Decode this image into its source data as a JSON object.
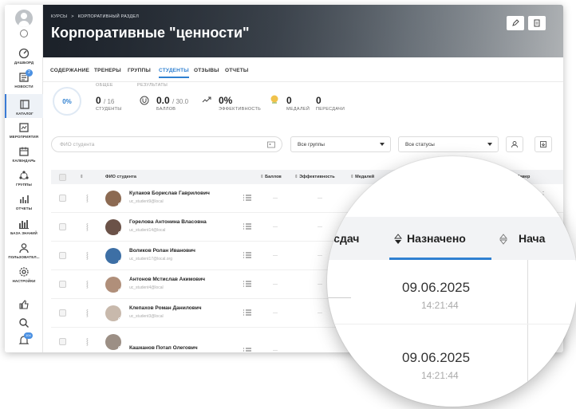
{
  "sidebar": {
    "items": [
      {
        "label": "ДАШБОРД",
        "icon": "dashboard-icon"
      },
      {
        "label": "НОВОСТИ",
        "icon": "news-icon",
        "badge": "2"
      },
      {
        "label": "КАТАЛОГ",
        "icon": "catalog-icon",
        "active": true
      },
      {
        "label": "МЕРОПРИЯТИЯ",
        "icon": "events-icon"
      },
      {
        "label": "КАЛЕНДАРЬ",
        "icon": "calendar-icon"
      },
      {
        "label": "ГРУППЫ",
        "icon": "groups-icon"
      },
      {
        "label": "ОТЧЕТЫ",
        "icon": "reports-icon"
      },
      {
        "label": "БАЗА ЗНАНИЙ",
        "icon": "knowledge-icon"
      },
      {
        "label": "ПОЛЬЗОВАТЕЛ...",
        "icon": "users-icon"
      },
      {
        "label": "НАСТРОЙКИ",
        "icon": "settings-icon"
      }
    ],
    "bottom_badge": "104"
  },
  "header": {
    "breadcrumb": [
      "КУРСЫ",
      "КОРПОРАТИВНЫЙ РАЗДЕЛ"
    ],
    "breadcrumb_sep": ">",
    "title": "Корпоративные \"ценности\""
  },
  "tabs": [
    "СОДЕРЖАНИЕ",
    "ТРЕНЕРЫ",
    "ГРУППЫ",
    "СТУДЕНТЫ",
    "ОТЗЫВЫ",
    "ОТЧЕТЫ"
  ],
  "active_tab": "СТУДЕНТЫ",
  "stats": {
    "progress": "0%",
    "general_label": "ОБЩЕЕ",
    "results_label": "РЕЗУЛЬТАТЫ",
    "students_value": "0",
    "students_total": "/ 16",
    "students_label": "СТУДЕНТЫ",
    "points_value": "0.0",
    "points_total": "/ 30.0",
    "points_label": "БАЛЛОВ",
    "efficiency_value": "0%",
    "efficiency_label": "ЭФФЕКТИВНОСТЬ",
    "medals_value": "0",
    "medals_label": "МЕДАЛЕЙ",
    "retakes_value": "0",
    "retakes_label": "ПЕРЕСДАЧИ"
  },
  "filters": {
    "search_placeholder": "ФИО студента",
    "group_select": "Все группы",
    "status_select": "Все статусы"
  },
  "table": {
    "headers": {
      "name": "ФИО студента",
      "points": "Баллов",
      "efficiency": "Эффективность",
      "medals": "Медалей",
      "completed": "Завер"
    },
    "rows": [
      {
        "name": "Кулаков Борислав Гаврилович",
        "email": "uc_student9@local",
        "dash": "—"
      },
      {
        "name": "Горелова Антонина Власовна",
        "email": "uc_student14@local",
        "dash": "—"
      },
      {
        "name": "Воликов Ролан Иванович",
        "email": "uc_student17@local.org",
        "dash": "—"
      },
      {
        "name": "Антонов Мстислав Акимович",
        "email": "uc_student4@local",
        "dash": "—"
      },
      {
        "name": "Клепахов Роман Данилович",
        "email": "uc_student3@local",
        "dash": "—"
      },
      {
        "name": "Кашканов Потап Олегович",
        "email": "",
        "dash": "—"
      }
    ]
  },
  "magnifier": {
    "col_left": "ресдач",
    "col_assigned": "Назначено",
    "col_right": "Нача",
    "date1": "09.06.2025",
    "time1": "14:21:44",
    "date2": "09.06.2025",
    "time2": "14:21:44"
  },
  "colors": {
    "accent": "#2f80d1",
    "badge": "#4a90e2"
  }
}
